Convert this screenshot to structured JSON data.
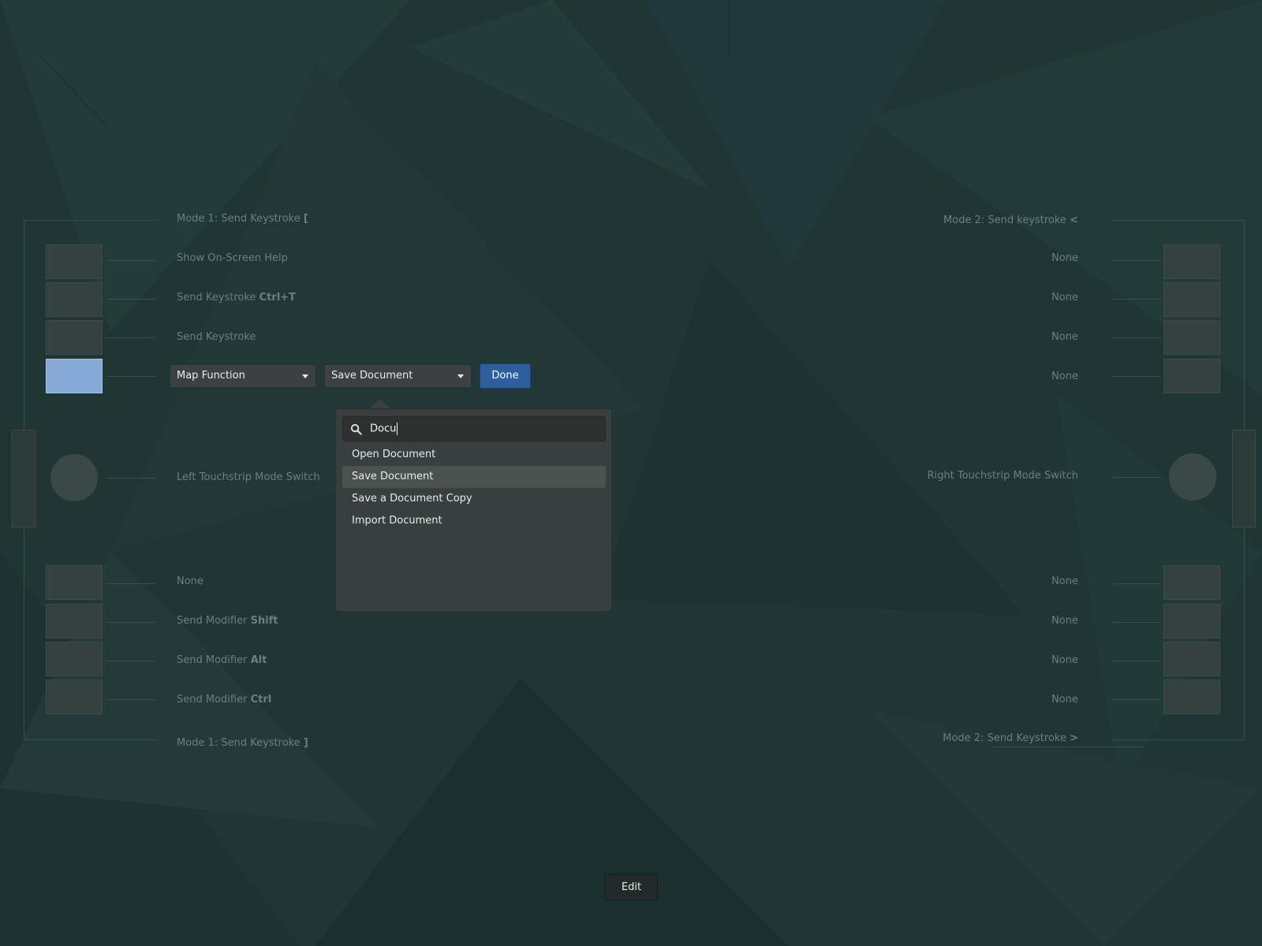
{
  "left": {
    "top_mode": {
      "text": "Mode 1: Send Keystroke ",
      "key": "["
    },
    "buttons": [
      {
        "text": "Show On-Screen Help",
        "key": ""
      },
      {
        "text": "Send Keystroke ",
        "key": "Ctrl+T"
      },
      {
        "text": "Send Keystroke",
        "key": ""
      }
    ],
    "editor": {
      "type_combo": "Map Function",
      "action_combo": "Save Document",
      "done_label": "Done"
    },
    "touchstrip_label": "Left Touchstrip Mode Switch",
    "lower_buttons": [
      {
        "text": "None",
        "key": ""
      },
      {
        "text": "Send Modifier ",
        "key": "Shift"
      },
      {
        "text": "Send Modifier ",
        "key": "Alt"
      },
      {
        "text": "Send Modifier ",
        "key": "Ctrl"
      }
    ],
    "bottom_mode": {
      "text": "Mode 1: Send Keystroke ",
      "key": "]"
    }
  },
  "right": {
    "top_mode": {
      "text": "Mode 2: Send keystroke ",
      "key": "<"
    },
    "buttons": [
      "None",
      "None",
      "None",
      "None"
    ],
    "touchstrip_label": "Right Touchstrip Mode Switch",
    "lower_buttons": [
      "None",
      "None",
      "None",
      "None"
    ],
    "bottom_mode": {
      "text": "Mode 2: Send Keystroke ",
      "key": ">"
    }
  },
  "popover": {
    "search_value": "Docu",
    "options": [
      "Open Document",
      "Save Document",
      "Save a Document Copy",
      "Import Document"
    ],
    "selected": "Save Document"
  },
  "edit_label": "Edit"
}
